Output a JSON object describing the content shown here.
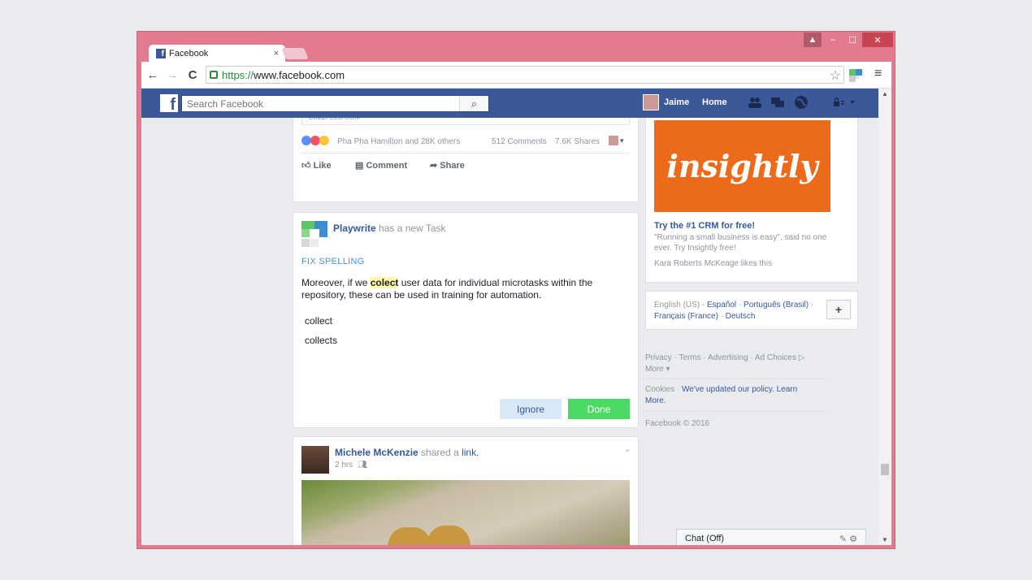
{
  "window": {
    "tab_title": "Facebook",
    "tab_close": "×",
    "controls": {
      "min": "–",
      "max": "☐",
      "close": "✕",
      "user": "▲"
    }
  },
  "toolbar": {
    "back": "←",
    "forward": "→",
    "reload": "C",
    "url_scheme": "https://",
    "url_rest": "www.facebook.com",
    "star": "☆",
    "menu": "≡"
  },
  "fbbar": {
    "logo": "f",
    "search_placeholder": "Search Facebook",
    "search_icon": "⌕",
    "user_name": "Jaime",
    "home": "Home"
  },
  "post1": {
    "source": "BUZZFEED.COM",
    "reactions_text": "Pha Pha Hamilton and 28K others",
    "comments": "512 Comments",
    "shares": "7.6K Shares",
    "like": "Like",
    "comment": "Comment",
    "share": "Share"
  },
  "task": {
    "app": "Playwrite",
    "suffix": "has a new Task",
    "heading": "FIX SPELLING",
    "text_before": "Moreover, if we ",
    "highlight": "colect",
    "text_after": " user data for individual microtasks within the repository, these can be used in training for automation.",
    "options": [
      "collect",
      "collects"
    ],
    "ignore": "Ignore",
    "done": "Done"
  },
  "post2": {
    "name": "Michele McKenzie",
    "mid": "shared a",
    "link": "link.",
    "time": "2 hrs",
    "caret": "⌄"
  },
  "ad": {
    "brand": "insightly",
    "title": "Try the #1 CRM for free!",
    "desc": "\"Running a small business is easy\", said no one ever. Try Insightly free!",
    "likes": "Kara Roberts McKeage likes this"
  },
  "languages": {
    "current": "English (US) · ",
    "l1": "Español",
    "sep1": " · ",
    "l2": "Português (Brasil)",
    "sep2": " · ",
    "l3": "Français (France)",
    "sep3": " · ",
    "l4": "Deutsch",
    "plus": "+"
  },
  "footer": {
    "links1": "Privacy · Terms · Advertising · Ad Choices ▷",
    "more": "More ▾",
    "cookies": "Cookies · ",
    "policy": "We've updated our policy.",
    "learn": "Learn More.",
    "copyright": "Facebook © 2016"
  },
  "chat": {
    "label": "Chat (Off)",
    "icons": "✎ ⚙"
  },
  "colors": {
    "fb_blue": "#3b5998",
    "done_green": "#4cd964",
    "ad_orange": "#ec6b1a",
    "window_frame": "#e27b8e"
  }
}
